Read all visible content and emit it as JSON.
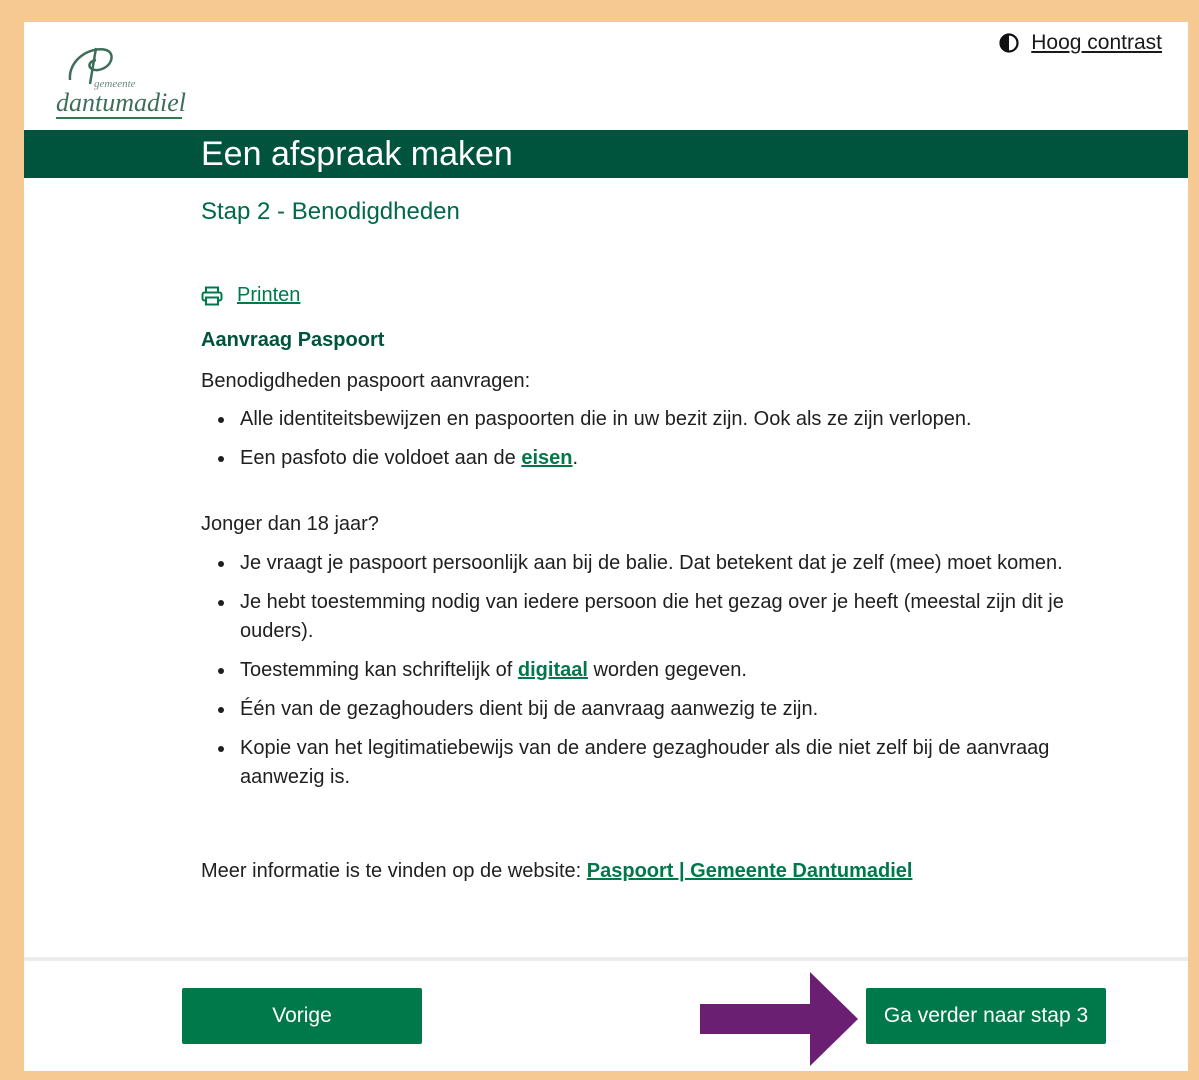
{
  "header": {
    "logo": {
      "subtitle": "gemeente",
      "name": "dantumadiel"
    },
    "contrast_label": "Hoog contrast"
  },
  "banner": {
    "title": "Een afspraak maken"
  },
  "step": {
    "title": "Stap 2 - Benodigdheden"
  },
  "print_label": "Printen",
  "section": {
    "title": "Aanvraag Paspoort",
    "intro": "Benodigdheden paspoort aanvragen:",
    "items": [
      {
        "text": "Alle identiteitsbewijzen en paspoorten die in uw bezit zijn. Ook als ze zijn verlopen."
      },
      {
        "prefix": "Een pasfoto die voldoet aan de ",
        "link": "eisen",
        "suffix": "."
      }
    ],
    "minors_intro": "Jonger dan 18 jaar?",
    "minors_items": [
      {
        "text": "Je vraagt je paspoort persoonlijk aan bij de balie. Dat betekent dat je zelf (mee) moet komen."
      },
      {
        "text": "Je hebt toestemming nodig van iedere persoon die het gezag over je heeft (meestal zijn dit je ouders)."
      },
      {
        "prefix": "Toestemming kan schriftelijk of ",
        "link": "digitaal",
        "suffix": " worden gegeven."
      },
      {
        "text": "Één van de gezaghouders dient bij de aanvraag aanwezig te zijn."
      },
      {
        "text": "Kopie van het legitimatiebewijs van de andere gezaghouder als die niet zelf bij de aanvraag aanwezig is."
      }
    ],
    "more_info_prefix": "Meer informatie is te vinden op de website: ",
    "more_info_link": "Paspoort | Gemeente Dantumadiel"
  },
  "footer": {
    "prev_label": "Vorige",
    "next_label": "Ga verder naar stap 3"
  },
  "colors": {
    "brand_dark": "#00543d",
    "brand_button": "#00794a",
    "frame": "#f6c993",
    "arrow": "#6b1f73"
  },
  "icons": {
    "contrast": "half-circle-icon",
    "print": "printer-icon",
    "arrow": "arrow-right-icon"
  }
}
